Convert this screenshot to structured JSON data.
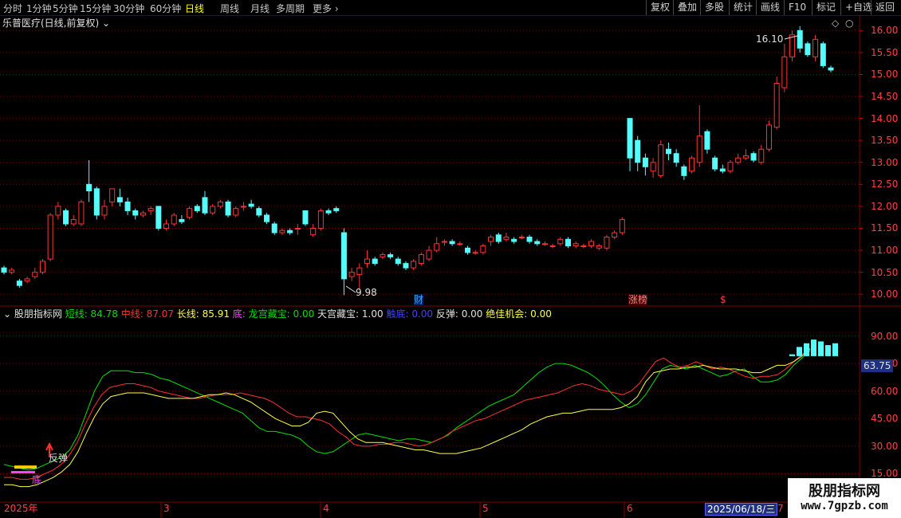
{
  "toolbar": {
    "periods": [
      "分时",
      "1分钟",
      "5分钟",
      "15分钟",
      "30分钟",
      "60分钟",
      "日线",
      "周线",
      "月线",
      "多周期",
      "更多"
    ],
    "active_period": "日线",
    "buttons": [
      "复权",
      "叠加",
      "多股",
      "统计",
      "画线",
      "F10",
      "标记",
      "+自选",
      "返回"
    ]
  },
  "main": {
    "title": "乐普医疗(日线,前复权)",
    "high_label": "16.10",
    "low_label": "9.98",
    "events": [
      "财",
      "涨榜",
      "$"
    ]
  },
  "indicator": {
    "name": "股朋指标网",
    "legend": [
      {
        "label": "短线:",
        "value": "84.78",
        "color": "#00e000"
      },
      {
        "label": "中线:",
        "value": "87.07",
        "color": "#ff3030"
      },
      {
        "label": "长线:",
        "value": "85.91",
        "color": "#ffff40"
      },
      {
        "label": "底:",
        "value": "",
        "color": "#ff40ff"
      },
      {
        "label": "龙宫藏宝:",
        "value": "0.00",
        "color": "#00e000"
      },
      {
        "label": "天宫藏宝:",
        "value": "1.00",
        "color": "#e0e0e0"
      },
      {
        "label": "触底:",
        "value": "0.00",
        "color": "#4040ff"
      },
      {
        "label": "反弹:",
        "value": "0.00",
        "color": "#e0e0e0"
      },
      {
        "label": "绝佳机会:",
        "value": "0.00",
        "color": "#ffff40"
      }
    ],
    "rebound_label": "反弹",
    "bottom_label": "底",
    "current_value": "63.75"
  },
  "price_axis": [
    "16.00",
    "15.50",
    "15.00",
    "14.50",
    "14.00",
    "13.50",
    "13.00",
    "12.50",
    "12.00",
    "11.50",
    "11.00",
    "10.50",
    "10.00"
  ],
  "indicator_axis": [
    "90.00",
    "75.00",
    "60.00",
    "45.00",
    "30.00",
    "15.00"
  ],
  "date_axis": {
    "year": "2025年",
    "months": [
      "3",
      "4",
      "5",
      "6",
      "7"
    ],
    "cursor_date": "2025/06/18/三"
  },
  "watermark": {
    "name": "股朋指标网",
    "url": "www.7gpzb.com"
  },
  "colors": {
    "up": "#ff3232",
    "down": "#54fcfc",
    "grid": "#800000",
    "short": "#00e000",
    "mid": "#ff3030",
    "long": "#ffff40"
  },
  "chart_data": {
    "type": "candlestick",
    "price_range": [
      9.75,
      16.35
    ],
    "candles": [
      [
        10.6,
        10.5,
        10.65,
        10.45
      ],
      [
        10.5,
        10.55,
        10.6,
        10.45
      ],
      [
        10.3,
        10.2,
        10.35,
        10.15
      ],
      [
        10.3,
        10.35,
        10.4,
        10.25
      ],
      [
        10.4,
        10.5,
        10.6,
        10.35
      ],
      [
        10.5,
        10.75,
        10.8,
        10.45
      ],
      [
        10.8,
        11.8,
        11.85,
        10.75
      ],
      [
        11.8,
        12.0,
        12.1,
        11.7
      ],
      [
        11.9,
        11.6,
        11.95,
        11.55
      ],
      [
        11.6,
        11.7,
        11.8,
        11.55
      ],
      [
        11.6,
        12.1,
        12.15,
        11.55
      ],
      [
        12.5,
        12.35,
        13.05,
        12.1
      ],
      [
        12.4,
        11.8,
        12.45,
        11.7
      ],
      [
        11.8,
        12.0,
        12.15,
        11.7
      ],
      [
        12.1,
        12.4,
        12.4,
        12.0
      ],
      [
        12.2,
        12.1,
        12.4,
        12.0
      ],
      [
        12.1,
        11.9,
        12.2,
        11.8
      ],
      [
        11.9,
        11.8,
        11.95,
        11.7
      ],
      [
        11.8,
        11.85,
        11.9,
        11.75
      ],
      [
        11.9,
        11.95,
        12.0,
        11.8
      ],
      [
        12.0,
        11.5,
        12.0,
        11.45
      ],
      [
        11.5,
        11.6,
        11.7,
        11.45
      ],
      [
        11.6,
        11.8,
        11.85,
        11.55
      ],
      [
        11.7,
        11.65,
        11.8,
        11.6
      ],
      [
        11.75,
        11.95,
        12.0,
        11.7
      ],
      [
        12.0,
        11.9,
        12.05,
        11.85
      ],
      [
        12.2,
        11.85,
        12.35,
        11.8
      ],
      [
        11.85,
        12.0,
        12.05,
        11.8
      ],
      [
        12.0,
        12.1,
        12.15,
        11.95
      ],
      [
        12.1,
        11.8,
        12.15,
        11.75
      ],
      [
        11.8,
        11.95,
        12.0,
        11.75
      ],
      [
        12.0,
        12.0,
        12.1,
        11.9
      ],
      [
        12.05,
        12.0,
        12.15,
        11.95
      ],
      [
        11.95,
        11.8,
        12.0,
        11.75
      ],
      [
        11.8,
        11.65,
        11.85,
        11.6
      ],
      [
        11.6,
        11.4,
        11.65,
        11.35
      ],
      [
        11.4,
        11.45,
        11.5,
        11.35
      ],
      [
        11.45,
        11.4,
        11.5,
        11.35
      ],
      [
        11.5,
        11.5,
        11.6,
        11.35
      ],
      [
        11.9,
        11.6,
        11.9,
        11.55
      ],
      [
        11.35,
        11.5,
        11.6,
        11.3
      ],
      [
        11.5,
        11.9,
        11.95,
        11.45
      ],
      [
        11.9,
        11.85,
        11.95,
        11.8
      ],
      [
        11.95,
        11.9,
        12.0,
        11.85
      ],
      [
        11.4,
        10.35,
        11.5,
        9.98
      ],
      [
        10.4,
        10.5,
        10.6,
        10.3
      ],
      [
        10.45,
        10.6,
        10.7,
        10.1
      ],
      [
        10.7,
        10.8,
        11.0,
        10.6
      ],
      [
        10.8,
        10.7,
        10.85,
        10.65
      ],
      [
        10.85,
        10.9,
        10.95,
        10.8
      ],
      [
        10.9,
        10.85,
        10.95,
        10.8
      ],
      [
        10.8,
        10.7,
        10.85,
        10.65
      ],
      [
        10.7,
        10.6,
        10.75,
        10.55
      ],
      [
        10.6,
        10.75,
        10.8,
        10.55
      ],
      [
        10.7,
        10.9,
        10.95,
        10.65
      ],
      [
        10.8,
        11.0,
        11.1,
        10.75
      ],
      [
        11.0,
        11.15,
        11.3,
        10.95
      ],
      [
        11.2,
        11.2,
        11.25,
        11.1
      ],
      [
        11.2,
        11.15,
        11.25,
        11.1
      ],
      [
        11.15,
        11.15,
        11.2,
        11.1
      ],
      [
        11.05,
        10.95,
        11.1,
        10.9
      ],
      [
        10.95,
        10.95,
        11.0,
        10.9
      ],
      [
        10.95,
        11.1,
        11.15,
        10.9
      ],
      [
        11.2,
        11.3,
        11.35,
        11.1
      ],
      [
        11.35,
        11.2,
        11.4,
        11.15
      ],
      [
        11.25,
        11.3,
        11.4,
        11.2
      ],
      [
        11.25,
        11.2,
        11.3,
        11.15
      ],
      [
        11.3,
        11.3,
        11.35,
        11.25
      ],
      [
        11.3,
        11.2,
        11.35,
        11.15
      ],
      [
        11.2,
        11.15,
        11.25,
        11.1
      ],
      [
        11.15,
        11.15,
        11.2,
        11.1
      ],
      [
        11.1,
        11.1,
        11.15,
        11.05
      ],
      [
        11.15,
        11.25,
        11.3,
        11.1
      ],
      [
        11.25,
        11.1,
        11.3,
        11.05
      ],
      [
        11.1,
        11.15,
        11.2,
        11.05
      ],
      [
        11.1,
        11.1,
        11.15,
        11.05
      ],
      [
        11.1,
        11.2,
        11.25,
        11.05
      ],
      [
        11.05,
        11.1,
        11.15,
        11.0
      ],
      [
        11.05,
        11.3,
        11.35,
        11.0
      ],
      [
        11.3,
        11.4,
        11.45,
        11.25
      ],
      [
        11.4,
        11.7,
        11.75,
        11.35
      ],
      [
        14.0,
        13.1,
        14.0,
        12.8
      ],
      [
        13.5,
        13.0,
        13.6,
        12.8
      ],
      [
        13.1,
        12.9,
        13.2,
        12.7
      ],
      [
        12.8,
        13.0,
        13.1,
        12.65
      ],
      [
        12.7,
        13.4,
        13.5,
        12.65
      ],
      [
        13.3,
        13.2,
        13.45,
        13.05
      ],
      [
        13.2,
        13.0,
        13.3,
        12.9
      ],
      [
        12.9,
        12.7,
        12.95,
        12.6
      ],
      [
        12.8,
        13.1,
        13.15,
        12.75
      ],
      [
        13.0,
        13.6,
        14.3,
        12.9
      ],
      [
        13.7,
        13.3,
        13.75,
        13.2
      ],
      [
        13.1,
        12.85,
        13.15,
        12.8
      ],
      [
        12.85,
        12.8,
        12.95,
        12.75
      ],
      [
        12.8,
        13.0,
        13.05,
        12.75
      ],
      [
        13.0,
        13.1,
        13.2,
        12.95
      ],
      [
        13.1,
        13.15,
        13.3,
        13.05
      ],
      [
        13.2,
        13.05,
        13.25,
        13.0
      ],
      [
        13.0,
        13.3,
        13.4,
        12.95
      ],
      [
        13.3,
        13.85,
        13.95,
        13.25
      ],
      [
        13.8,
        14.8,
        14.95,
        13.75
      ],
      [
        14.7,
        15.4,
        15.7,
        14.6
      ],
      [
        15.4,
        15.9,
        16.0,
        15.3
      ],
      [
        16.0,
        15.6,
        16.1,
        15.5
      ],
      [
        15.7,
        15.45,
        15.75,
        15.4
      ],
      [
        15.4,
        15.8,
        15.9,
        15.3
      ],
      [
        15.7,
        15.2,
        15.75,
        15.15
      ],
      [
        15.15,
        15.1,
        15.2,
        15.05
      ]
    ],
    "indicator_series": [
      {
        "name": "短线",
        "values": [
          20,
          19,
          18,
          17,
          18,
          20,
          22,
          24,
          28,
          36,
          48,
          60,
          68,
          71,
          71,
          71,
          70,
          70,
          69,
          67,
          66,
          64,
          62,
          60,
          58,
          56,
          54,
          52,
          50,
          48,
          44,
          40,
          38,
          38,
          37,
          36,
          34,
          30,
          27,
          26,
          27,
          30,
          33,
          36,
          37,
          36,
          35,
          34,
          33,
          34,
          34,
          33,
          32,
          34,
          36,
          40,
          43,
          46,
          49,
          52,
          54,
          56,
          58,
          62,
          66,
          70,
          73,
          75,
          75,
          74,
          72,
          70,
          67,
          63,
          58,
          54,
          51,
          53,
          58,
          65,
          72,
          74,
          73,
          72,
          74,
          72,
          70,
          68,
          69,
          71,
          72,
          68,
          65,
          65,
          66,
          69,
          74,
          78,
          82
        ]
      },
      {
        "name": "中线",
        "values": [
          13,
          13,
          12,
          12,
          13,
          15,
          17,
          20,
          25,
          32,
          42,
          51,
          58,
          62,
          63,
          64,
          64,
          63,
          62,
          60,
          59,
          58,
          57,
          56,
          56,
          57,
          58,
          58,
          58,
          59,
          58,
          57,
          56,
          54,
          51,
          48,
          46,
          46,
          45,
          44,
          42,
          38,
          35,
          31,
          30,
          30,
          31,
          31,
          32,
          32,
          31,
          30,
          31,
          33,
          35,
          38,
          40,
          42,
          44,
          45,
          47,
          49,
          51,
          53,
          55,
          56,
          57,
          58,
          59,
          61,
          63,
          64,
          63,
          61,
          60,
          59,
          58,
          60,
          64,
          70,
          76,
          78,
          75,
          73,
          74,
          76,
          74,
          72,
          73,
          72,
          70,
          68,
          67,
          68,
          68,
          69,
          72,
          76,
          80,
          83
        ]
      },
      {
        "name": "长线",
        "values": [
          9,
          9,
          8,
          8,
          9,
          11,
          13,
          16,
          20,
          27,
          37,
          46,
          53,
          57,
          58,
          59,
          59,
          59,
          58,
          57,
          56,
          56,
          56,
          56,
          57,
          58,
          58,
          59,
          58,
          56,
          54,
          51,
          48,
          45,
          43,
          41,
          41,
          43,
          48,
          49,
          48,
          43,
          38,
          34,
          32,
          32,
          32,
          31,
          30,
          29,
          28,
          28,
          27,
          26,
          26,
          26,
          27,
          28,
          29,
          31,
          33,
          35,
          37,
          39,
          42,
          44,
          46,
          47,
          48,
          48,
          49,
          50,
          50,
          50,
          50,
          51,
          53,
          57,
          65,
          70,
          71,
          72,
          72,
          73,
          73,
          74,
          73,
          72,
          72,
          72,
          71,
          70,
          70,
          72,
          74,
          74,
          76,
          79,
          83
        ]
      }
    ],
    "indicator_range": [
      10,
      95
    ],
    "histogram_last": [
      80,
      84,
      86,
      88,
      87,
      85,
      86
    ]
  }
}
